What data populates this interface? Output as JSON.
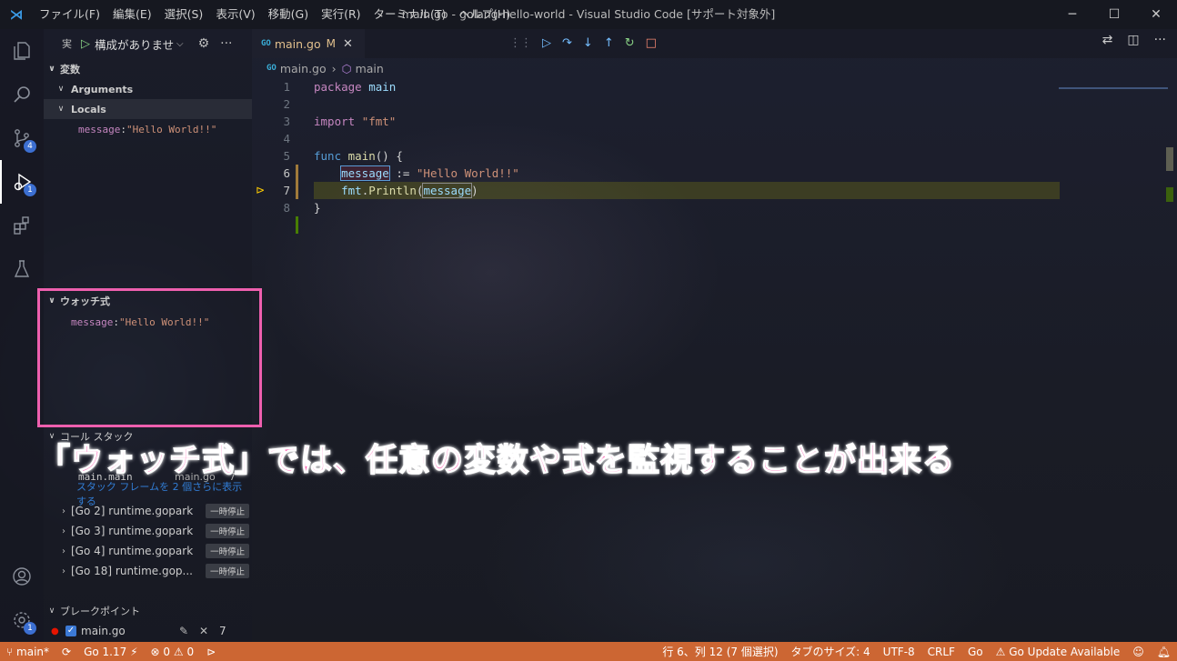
{
  "window": {
    "title": "main.go - golang-hello-world - Visual Studio Code [サポート対象外]",
    "menu": [
      "ファイル(F)",
      "編集(E)",
      "選択(S)",
      "表示(V)",
      "移動(G)",
      "実行(R)",
      "ターミナル(T)",
      "ヘルプ(H)"
    ],
    "controls": {
      "minimize": "─",
      "maximize": "☐",
      "close": "✕"
    }
  },
  "activity_bar": {
    "badges": {
      "scm": "4",
      "debug": "1",
      "accounts_settings": "1"
    }
  },
  "sidebar": {
    "header": {
      "label": "実",
      "config": "構成がありませ",
      "chevron": "⌵",
      "gear": "⚙",
      "more": "···"
    },
    "variables": {
      "title": "変数",
      "arguments": "Arguments",
      "locals": "Locals",
      "items": [
        {
          "name": "message",
          "value": "\"Hello World!!\""
        }
      ]
    },
    "watch": {
      "title": "ウォッチ式",
      "items": [
        {
          "name": "message",
          "value": "\"Hello World!!\""
        }
      ]
    },
    "call_stack": {
      "title": "コール スタック",
      "frame": {
        "func": "main.main",
        "file": "main.go",
        "line": "7"
      },
      "show_more": "スタック フレームを 2 個さらに表示する",
      "goroutines": [
        {
          "label": "[Go 2] runtime.gopark",
          "state": "一時停止"
        },
        {
          "label": "[Go 3] runtime.gopark",
          "state": "一時停止"
        },
        {
          "label": "[Go 4] runtime.gopark",
          "state": "一時停止"
        },
        {
          "label": "[Go 18] runtime.gop...",
          "state": "一時停止"
        }
      ]
    },
    "breakpoints": {
      "title": "ブレークポイント",
      "item": {
        "file": "main.go",
        "line": "7"
      }
    }
  },
  "editor": {
    "tab": {
      "icon_text": "GO",
      "name": "main.go",
      "modified": "M",
      "close": "✕"
    },
    "breadcrumb": {
      "file": "main.go",
      "symbol": "main"
    },
    "debug_toolbar": {
      "grip": "⋮⋮",
      "continue": "▷",
      "step_over": "↷",
      "step_into": "↓",
      "step_out": "↑",
      "restart": "↻",
      "stop": "□"
    },
    "lines": [
      {
        "n": "1",
        "parts": [
          [
            "kw",
            "package"
          ],
          [
            "plain",
            " "
          ],
          [
            "id",
            "main"
          ]
        ]
      },
      {
        "n": "2",
        "parts": []
      },
      {
        "n": "3",
        "parts": [
          [
            "kw",
            "import"
          ],
          [
            "plain",
            " "
          ],
          [
            "str",
            "\"fmt\""
          ]
        ]
      },
      {
        "n": "4",
        "parts": []
      },
      {
        "n": "5",
        "parts": [
          [
            "kw2",
            "func"
          ],
          [
            "plain",
            " "
          ],
          [
            "fn",
            "main"
          ],
          [
            "plain",
            "() {"
          ]
        ]
      },
      {
        "n": "6",
        "parts": [
          [
            "plain",
            "    "
          ],
          [
            "id",
            "message"
          ],
          [
            "plain",
            " := "
          ],
          [
            "str",
            "\"Hello World!!\""
          ]
        ]
      },
      {
        "n": "7",
        "parts": [
          [
            "plain",
            "    "
          ],
          [
            "id",
            "fmt"
          ],
          [
            "plain",
            "."
          ],
          [
            "fn",
            "Println"
          ],
          [
            "plain",
            "("
          ],
          [
            "id",
            "message"
          ],
          [
            "plain",
            ")"
          ]
        ]
      },
      {
        "n": "8",
        "parts": [
          [
            "plain",
            "}"
          ]
        ]
      }
    ]
  },
  "annotation": "「ウォッチ式」では、任意の変数や式を監視することが出来る",
  "status_bar": {
    "branch": "main*",
    "sync": "⟳",
    "go_version": "Go 1.17",
    "errors": "0",
    "warnings": "0",
    "position": "行 6、列 12 (7 個選択)",
    "tab_size": "タブのサイズ: 4",
    "encoding": "UTF-8",
    "eol": "CRLF",
    "language": "Go",
    "update": "Go Update Available"
  },
  "colors": {
    "status_bar": "#cc6633",
    "highlight_box": "#ee5fae",
    "annotation_text": "#ff5fb4",
    "current_line": "#6a6a1c"
  }
}
